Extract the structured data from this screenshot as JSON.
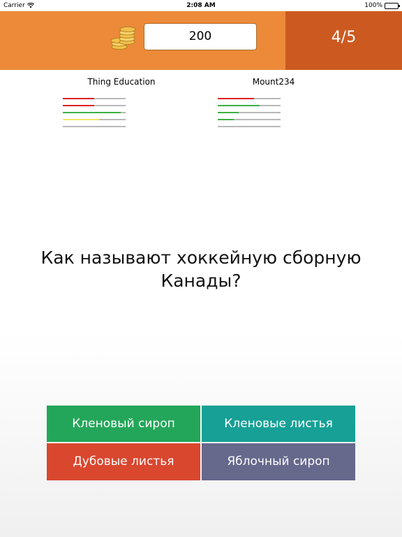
{
  "status_bar": {
    "carrier": "Carrier",
    "time": "2:08 AM",
    "battery": "100%"
  },
  "header": {
    "score": "200",
    "progress": "4/5",
    "colors": {
      "main": "#ec8a3a",
      "progress": "#cc5a20"
    },
    "icon": "coins-icon"
  },
  "players": [
    {
      "name": "Thing Education",
      "bars": [
        {
          "fill": 0.5,
          "color": "#e02020"
        },
        {
          "fill": 0.5,
          "color": "#e02020"
        },
        {
          "fill": 0.92,
          "color": "#3cb043"
        },
        {
          "fill": 0.58,
          "color": "#f5e26a"
        },
        {
          "fill": 0,
          "color": "#3cb043"
        }
      ]
    },
    {
      "name": "Mount234",
      "bars": [
        {
          "fill": 0.58,
          "color": "#e02020"
        },
        {
          "fill": 0.67,
          "color": "#3cb043"
        },
        {
          "fill": 0.33,
          "color": "#3cb043"
        },
        {
          "fill": 0.25,
          "color": "#3cb043"
        },
        {
          "fill": 0,
          "color": "#3cb043"
        }
      ]
    }
  ],
  "question": "Как называют хоккейную сборную Канады?",
  "answers": [
    {
      "label": "Кленовый сироп",
      "color": "#24a65a"
    },
    {
      "label": "Кленовые листья",
      "color": "#17a096"
    },
    {
      "label": "Дубовые листья",
      "color": "#d9472f"
    },
    {
      "label": "Яблочный сироп",
      "color": "#66688c"
    }
  ]
}
